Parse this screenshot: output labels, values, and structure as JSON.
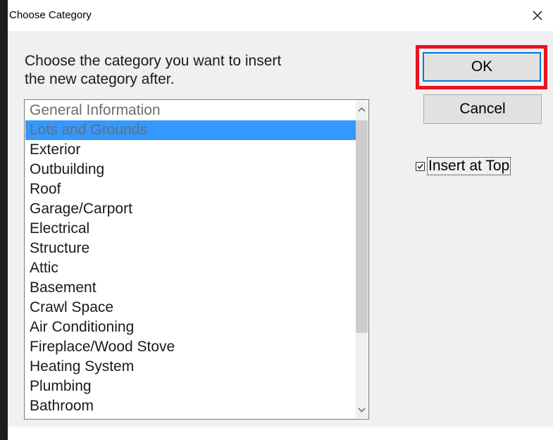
{
  "window": {
    "title": "Choose Category",
    "close_glyph": "×"
  },
  "dialog": {
    "prompt": "Choose the category you want to insert\nthe new category after.",
    "ok_label": "OK",
    "cancel_label": "Cancel",
    "checkbox_label": "Insert at Top",
    "checkbox_checked": true
  },
  "list": {
    "items": [
      "General Information",
      "Lots and Grounds",
      "Exterior",
      "Outbuilding",
      "Roof",
      "Garage/Carport",
      "Electrical",
      "Structure",
      "Attic",
      "Basement",
      "Crawl Space",
      "Air Conditioning",
      "Fireplace/Wood Stove",
      "Heating System",
      "Plumbing",
      "Bathroom"
    ],
    "selected_index": 1
  },
  "icons": {
    "close": "close-icon",
    "scroll_up": "chevron-up-icon",
    "scroll_down": "chevron-down-icon",
    "checkbox": "checkmark-icon"
  },
  "colors": {
    "selection": "#3399ff",
    "highlight": "#e8141f",
    "default_button_border": "#0078d7"
  }
}
